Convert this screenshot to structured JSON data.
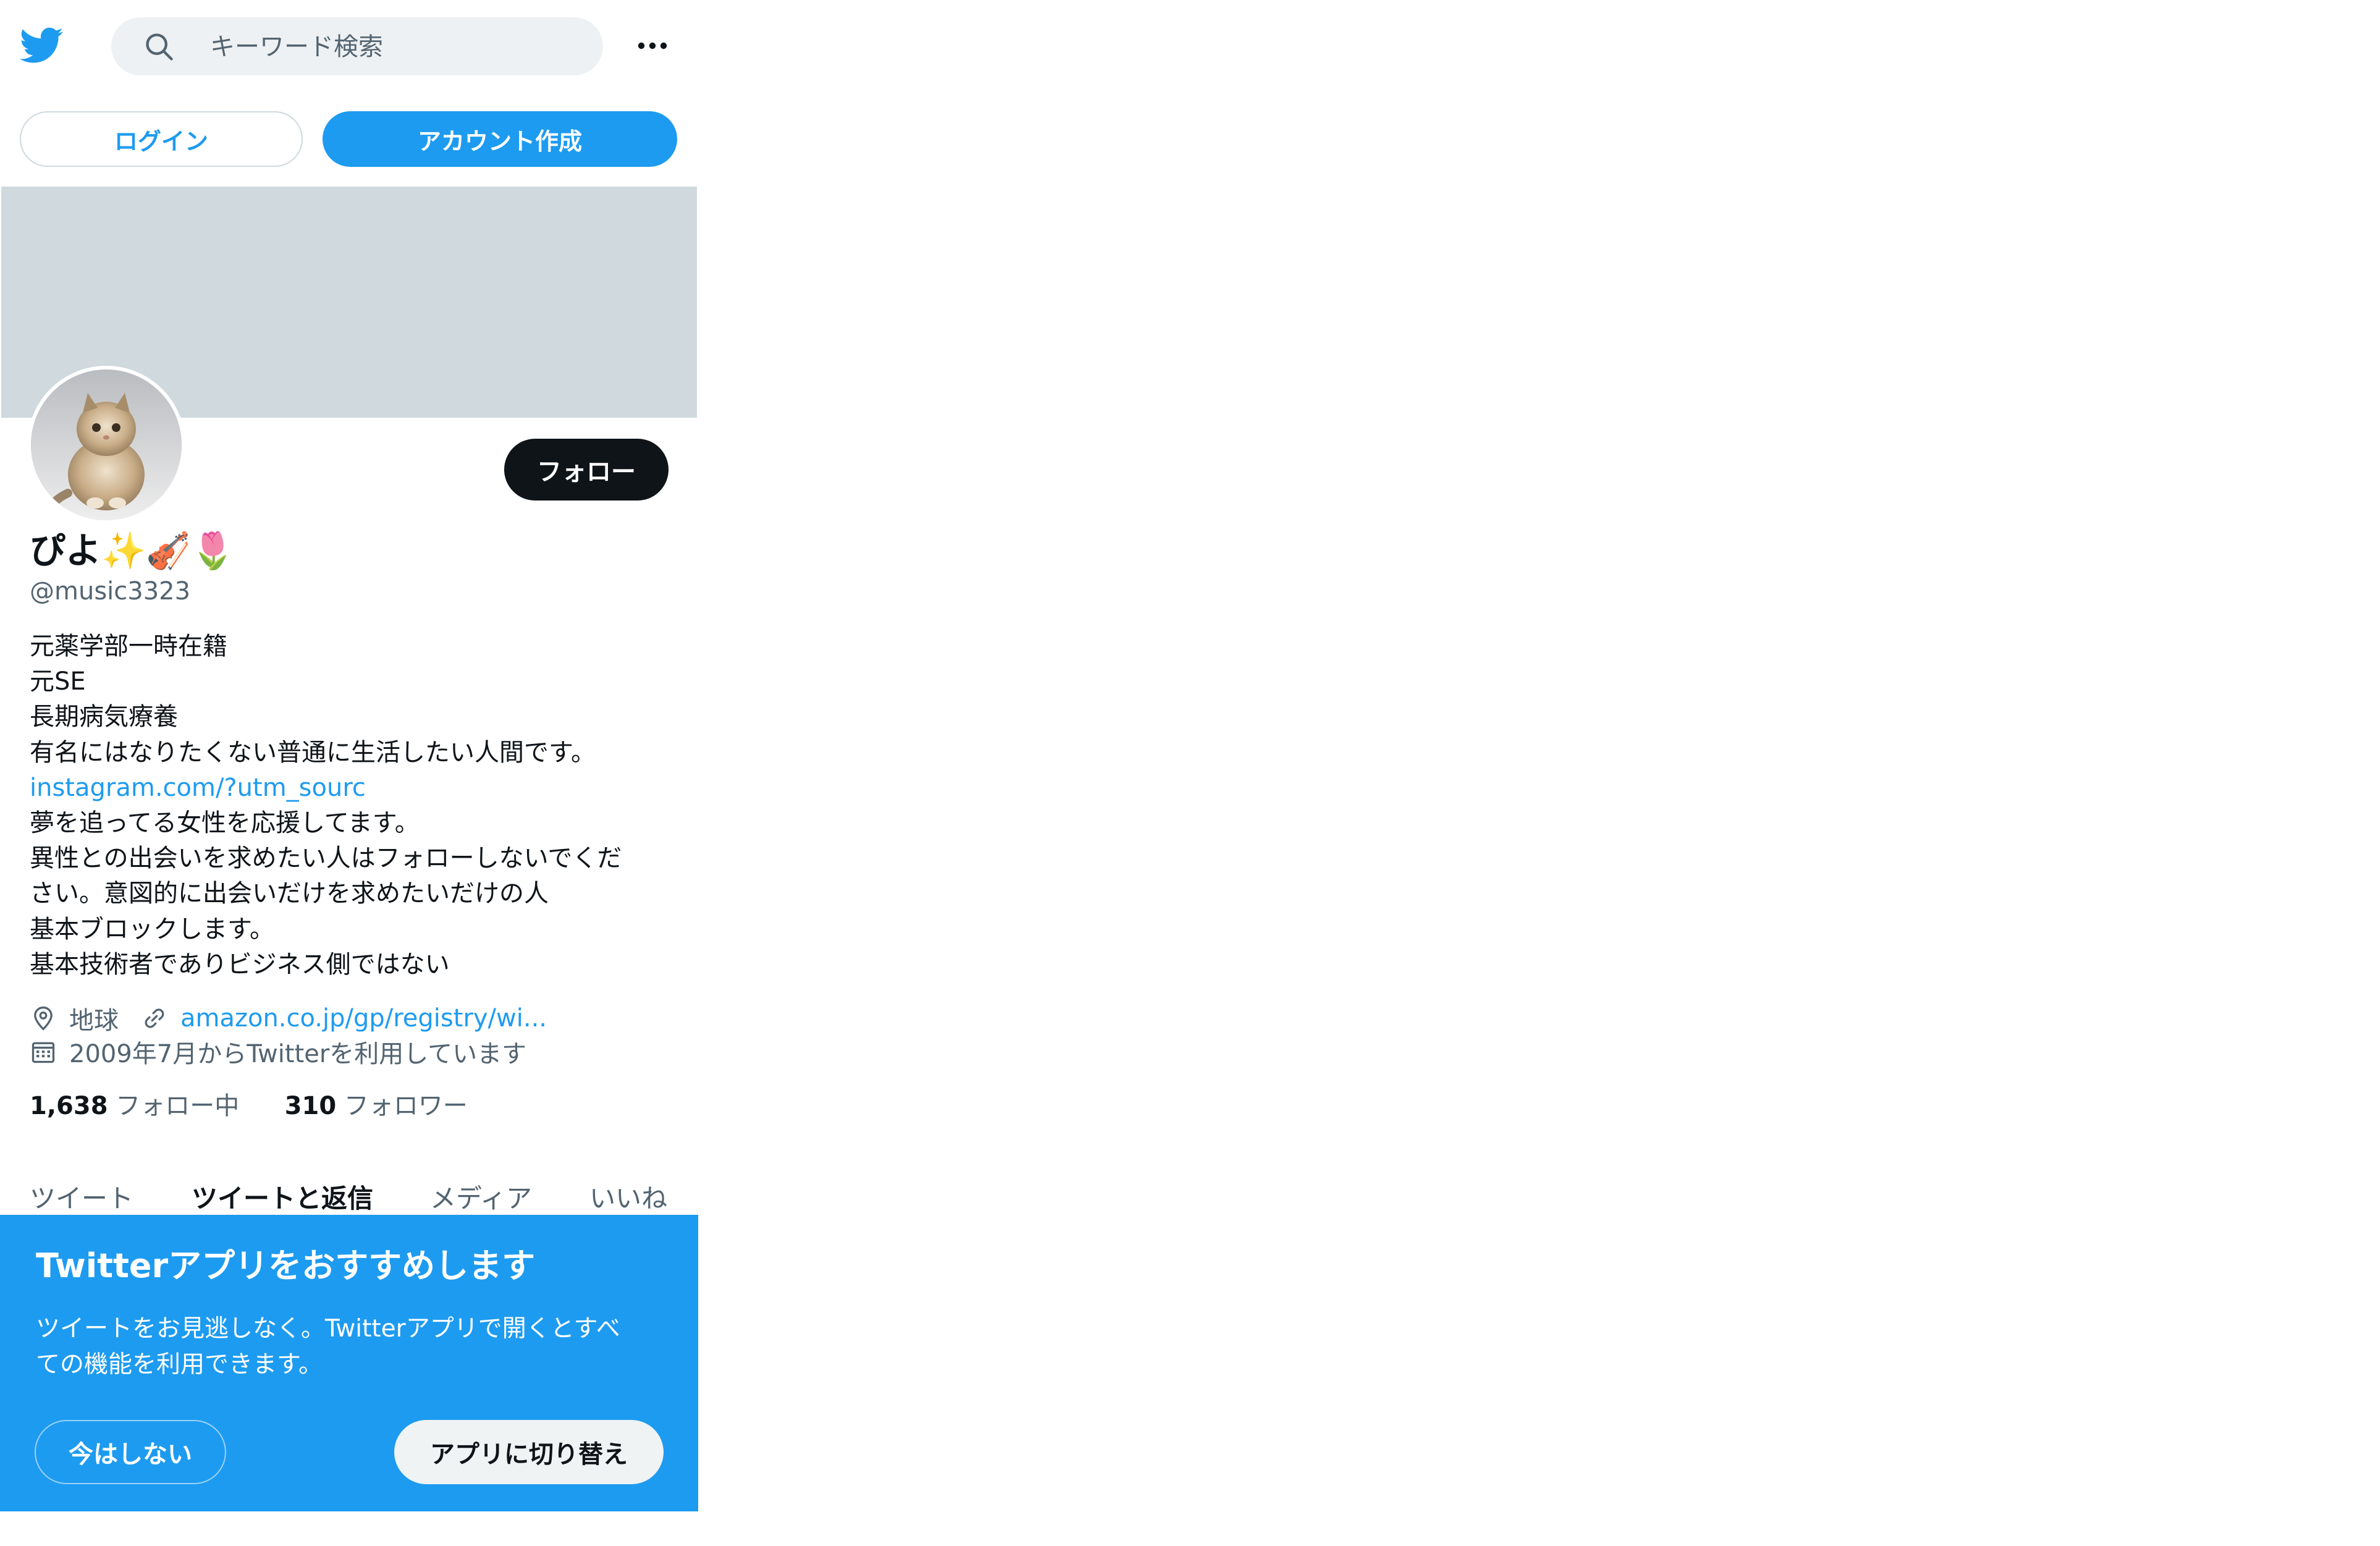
{
  "header": {
    "logo_icon": "twitter-bird-icon",
    "search_placeholder": "キーワード検索",
    "more_icon": "more-dots-icon"
  },
  "auth": {
    "login_label": "ログイン",
    "signup_label": "アカウント作成"
  },
  "profile": {
    "follow_label": "フォロー",
    "display_name": "ぴよ✨🎻🌷",
    "handle": "@music3323",
    "bio_lines": [
      "元薬学部一時在籍",
      "元SE",
      "長期病気療養",
      "有名にはなりたくない普通に生活したい人間です。",
      "instagram.com/?utm_sourc",
      "夢を追ってる女性を応援してます。",
      "異性との出会いを求めたい人はフォローしないでくだ",
      "さい。意図的に出会いだけを求めたいだけの人",
      "基本ブロックします。",
      "基本技術者でありビジネス側ではない"
    ],
    "location": "地球",
    "website": "amazon.co.jp/gp/registry/wi...",
    "joined": "2009年7月からTwitterを利用しています",
    "following_count": "1,638",
    "following_label": "フォロー中",
    "followers_count": "310",
    "followers_label": "フォロワー"
  },
  "tabs": [
    {
      "label": "ツイート",
      "active": false
    },
    {
      "label": "ツイートと返信",
      "active": true
    },
    {
      "label": "メディア",
      "active": false
    },
    {
      "label": "いいね",
      "active": false
    }
  ],
  "app_prompt": {
    "title": "Twitterアプリをおすすめします",
    "text_lines": [
      "ツイートをお見逃しなく。Twitterアプリで開くとすべ",
      "ての機能を利用できます。"
    ],
    "dismiss_label": "今はしない",
    "switch_label": "アプリに切り替え"
  },
  "colors": {
    "accent": "#1d9bf0",
    "banner": "#cfd9de",
    "text": "#0f1419",
    "secondary_text": "#536471"
  }
}
